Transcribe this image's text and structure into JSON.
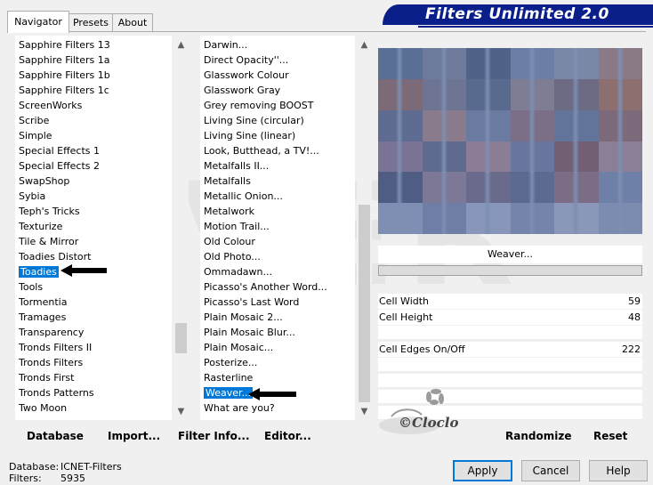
{
  "tabs": [
    {
      "label": "Navigator"
    },
    {
      "label": "Presets"
    },
    {
      "label": "About"
    }
  ],
  "banner": {
    "title": "Filters Unlimited 2.0"
  },
  "categories": {
    "items": [
      "Sapphire Filters 13",
      "Sapphire Filters 1a",
      "Sapphire Filters 1b",
      "Sapphire Filters 1c",
      "ScreenWorks",
      "Scribe",
      "Simple",
      "Special Effects 1",
      "Special Effects 2",
      "SwapShop",
      "Sybia",
      "Teph's Tricks",
      "Texturize",
      "Tile & Mirror",
      "Toadies Distort",
      "Toadies",
      "Tools",
      "Tormentia",
      "Tramages",
      "Transparency",
      "Tronds Filters II",
      "Tronds Filters",
      "Tronds First",
      "Tronds Patterns",
      "Two Moon"
    ],
    "selected": "Toadies",
    "selected_index": 15
  },
  "filters": {
    "items": [
      "Darwin...",
      "Direct Opacity''...",
      "Glasswork Colour",
      "Glasswork Gray",
      "Grey removing BOOST",
      "Living Sine (circular)",
      "Living Sine (linear)",
      "Look, Butthead, a TV!...",
      "Metalfalls II...",
      "Metalfalls",
      "Metallic Onion...",
      "Metalwork",
      "Motion Trail...",
      "Old Colour",
      "Old Photo...",
      "Ommadawn...",
      "Picasso's Another Word...",
      "Picasso's Last Word",
      "Plain Mosaic 2...",
      "Plain Mosaic Blur...",
      "Plain Mosaic...",
      "Posterize...",
      "Rasterline",
      "Weaver...",
      "What are you?"
    ],
    "selected": "Weaver..."
  },
  "preview": {
    "filter_name": "Weaver..."
  },
  "params": [
    {
      "label": "Cell Width",
      "value": "59"
    },
    {
      "label": "Cell Height",
      "value": "48"
    },
    {
      "label": "Cell Edges On/Off",
      "value": "222"
    }
  ],
  "bottom": {
    "database": "Database",
    "import": "Import...",
    "filter_info": "Filter Info...",
    "editor": "Editor...",
    "randomize": "Randomize",
    "reset": "Reset"
  },
  "info": {
    "database_label": "Database:",
    "database_value": "ICNET-Filters",
    "filters_label": "Filters:",
    "filters_value": "5935"
  },
  "buttons": {
    "apply": "Apply",
    "cancel": "Cancel",
    "help": "Help"
  },
  "watermark": {
    "text": "©Cloclo"
  },
  "colors": {
    "banner": "#0b1f8a",
    "selection": "#0078d7",
    "preview_base": "#6a7fa8"
  }
}
